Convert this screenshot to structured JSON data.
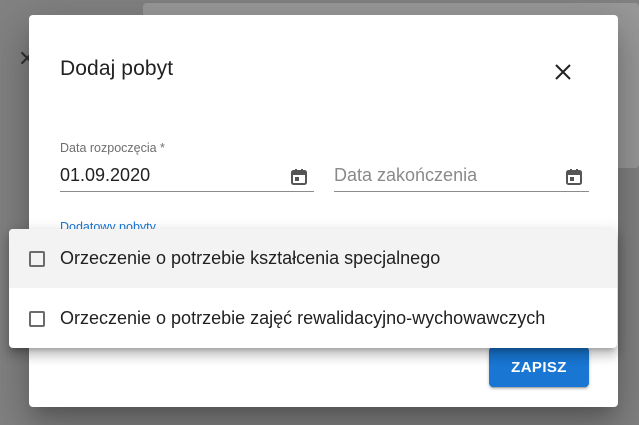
{
  "background": {
    "close_icon": "close-icon"
  },
  "dialog": {
    "title": "Dodaj pobyt",
    "close_icon": "close-icon",
    "start_date": {
      "label": "Data rozpoczęcia *",
      "value": "01.09.2020",
      "icon": "calendar-icon"
    },
    "end_date": {
      "placeholder": "Data zakończenia",
      "icon": "calendar-icon"
    },
    "extra_label": "Dodatowy pobyty",
    "save_label": "ZAPISZ"
  },
  "menu": {
    "items": [
      {
        "label": "Orzeczenie o potrzebie kształcenia specjalnego",
        "checked": false
      },
      {
        "label": "Orzeczenie o potrzebie zajęć rewalidacyjno-wychowawczych",
        "checked": false
      }
    ]
  },
  "colors": {
    "accent": "#1976d2",
    "overlay": "rgba(0,0,0,0.40)"
  }
}
